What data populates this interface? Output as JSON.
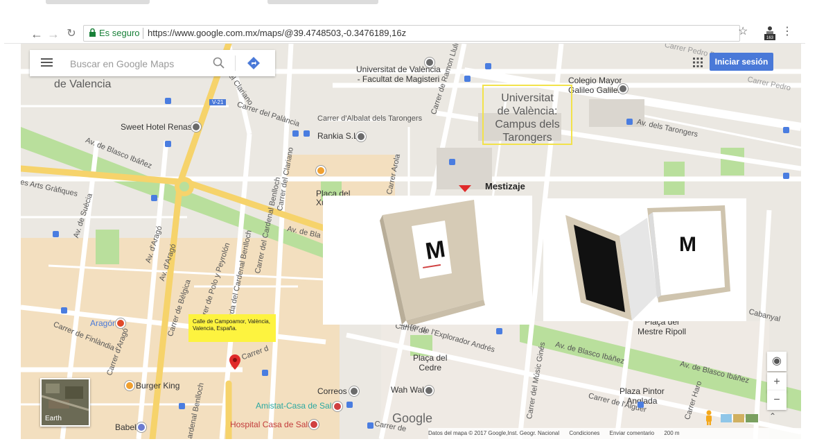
{
  "browser": {
    "secure_label": "Es seguro",
    "url": "https://www.google.com.mx/maps/@39.4748503,-0.3476189,16z",
    "extension_badge": "163",
    "icons": [
      "back-arrow-icon",
      "forward-arrow-icon",
      "reload-icon",
      "lock-icon",
      "star-icon",
      "extension-icon",
      "menu-dots-icon"
    ]
  },
  "search": {
    "placeholder": "Buscar en Google Maps"
  },
  "header": {
    "signin_label": "Iniciar sesión"
  },
  "map": {
    "places": {
      "de_valencia": "de Valencia",
      "facultat": [
        "Universitat de València",
        "- Facultat de Magisteri"
      ],
      "colegio": [
        "Colegio Mayor",
        "Galileo Galilei"
      ],
      "sweet_hotel": "Sweet Hotel Renasa",
      "rankia": "Rankia S.L",
      "placa_del": "Placa del",
      "placa_x": "Xu",
      "aragon": "Aragón",
      "burger_king": "Burger King",
      "correos": "Correos",
      "wah_wah": "Wah Wah",
      "amistat": "Amistat-Casa de Salud",
      "hospital": "Hospital Casa de Salud",
      "babel": "Babel",
      "placa_cedre": [
        "Plaça del",
        "Cedre"
      ],
      "placa_mestre": [
        "Plaça del",
        "Mestre Ripoll"
      ],
      "plaza_pintor": [
        "Plaza Pintor",
        "Anglada"
      ],
      "v21": "V-21"
    },
    "streets": {
      "clariano1": "Carrer del Clariano",
      "palancia": "Carrer del Palància",
      "albalat": "Carrer d'Albalat dels Tarongers",
      "ramon_llull": "Carrer de Ramon Llull",
      "pedro_duque": "Carrer Pedro Duque",
      "carrer_pedro": "Carrer Pedro",
      "tarongers": "Av. dels Tarongers",
      "blasco1": "Av. de Blasco Ibáñez",
      "blasco2": "Av. de Bla",
      "arts_grafiques": "les Arts Gràfiques",
      "suecia": "Av. de Suècia",
      "arago1": "Av. d'Aragó",
      "arago2": "Av. d'Aragó",
      "clariano2": "Carrer del Clariano",
      "polo": "Carrer de Polo y Peyrolón",
      "cardenal_benlloch": "Carrer del Cardenal Benlloch",
      "guda": "guda del Cardenal Benlloch",
      "belgica": "Carrer de Bèlgica",
      "finlandia": "Carrer de Finlàndia",
      "d_arago": "Carrer d'Aragó",
      "arola": "Carrer Arola",
      "explorador": "Carrer de l'Explorador Andrés",
      "blasco3": "Av. de Blasco Ibáñez",
      "blasco4": "Av. de Blasco Ibáñez",
      "music_gines": "Carrer del Músic Ginés",
      "alguer": "Carrer de l'Alguer",
      "haro": "Carrer Haro",
      "cabanyal": "Cabanyal",
      "cardenal_benlloch2": "ardenal Benlloch",
      "carrer_d": "Carrer d",
      "carrer_de": "Carrer de",
      "carrer_tail": "Carrer de"
    },
    "highlight_box": [
      "Universitat",
      "de València:",
      "Campus dels",
      "Tarongers"
    ],
    "marker_label": "Mestizaje",
    "note": "Calle de Campoamor, València, Valencia, España.",
    "earth_label": "Earth",
    "logo": "Google",
    "footer": {
      "data": "Datos del mapa © 2017 Google,Inst. Geogr. Nacional",
      "conditions": "Condiciones",
      "feedback": "Enviar comentario",
      "scale": "200 m"
    }
  },
  "colors": {
    "accent": "#4a79d8",
    "marker": "#e02a2a",
    "note_bg": "#fdf33f",
    "box_border": "#f2e24a",
    "road_yellow": "#f6d36b",
    "park": "#b9df9c"
  },
  "products": {
    "box_letter": "M",
    "open_letter": "M"
  }
}
